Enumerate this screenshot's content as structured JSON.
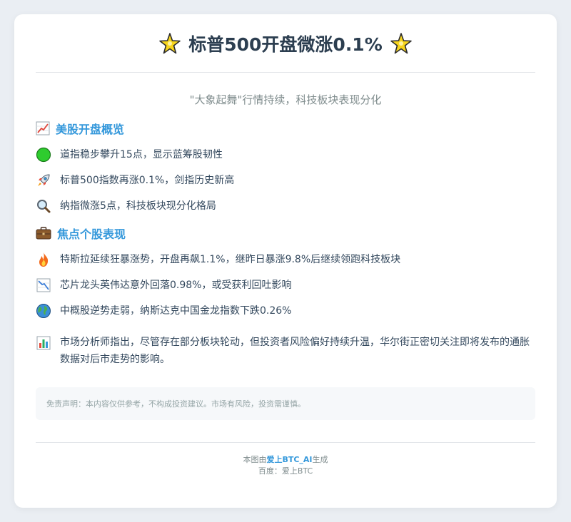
{
  "header": {
    "title": "标普500开盘微涨0.1%",
    "left_icon": "sparkle-icon",
    "right_icon": "sparkle-icon"
  },
  "subtitle": "\"大象起舞\"行情持续，科技板块表现分化",
  "sections": [
    {
      "icon": "chart-increasing-icon",
      "heading": "美股开盘概览",
      "items": [
        {
          "icon": "green-circle-icon",
          "text": "道指稳步攀升15点，显示蓝筹股韧性"
        },
        {
          "icon": "rocket-icon",
          "text": "标普500指数再涨0.1%，剑指历史新高"
        },
        {
          "icon": "magnifier-icon",
          "text": "纳指微涨5点，科技板块现分化格局"
        }
      ]
    },
    {
      "icon": "briefcase-icon",
      "heading": "焦点个股表现",
      "items": [
        {
          "icon": "fire-icon",
          "text": "特斯拉延续狂暴涨势，开盘再飙1.1%，继昨日暴涨9.8%后继续领跑科技板块"
        },
        {
          "icon": "chart-decreasing-icon",
          "text": "芯片龙头英伟达意外回落0.98%，或受获利回吐影响"
        },
        {
          "icon": "globe-icon",
          "text": "中概股逆势走弱，纳斯达克中国金龙指数下跌0.26%"
        }
      ]
    }
  ],
  "analysis": {
    "icon": "bar-chart-icon",
    "text": "市场分析师指出，尽管存在部分板块轮动，但投资者风险偏好持续升温，华尔街正密切关注即将发布的通胀数据对后市走势的影响。"
  },
  "disclaimer": "免责声明：本内容仅供参考，不构成投资建议。市场有风险，投资需谨慎。",
  "footer": {
    "prefix": "本图由",
    "brand": "爱上BTC_AI",
    "suffix": "生成",
    "line2": "百度：爱上BTC"
  },
  "colors": {
    "accent": "#3498db",
    "title": "#2c3e50",
    "background": "#eaeef3"
  }
}
